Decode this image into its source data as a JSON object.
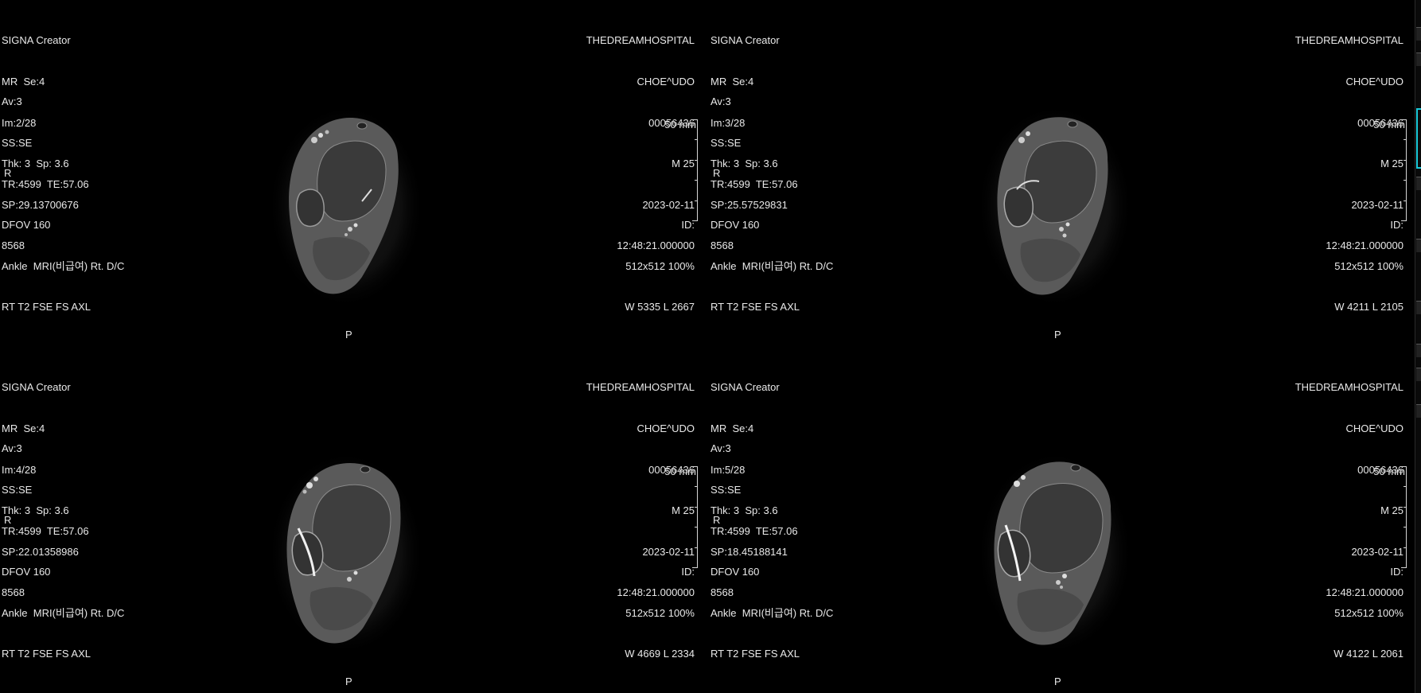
{
  "viewports": [
    {
      "top_left": [
        "SIGNA Creator",
        "MR  Se:4",
        "Im:2/28",
        "Thk: 3  Sp: 3.6",
        "SP:29.13700676",
        "8568"
      ],
      "top_right": [
        "THEDREAMHOSPITAL",
        "CHOE^UDO",
        "00056436",
        "M 25",
        "2023-02-11",
        "12:48:21.000000"
      ],
      "bottom_left": [
        "Av:3",
        "SS:SE",
        "TR:4599  TE:57.06",
        "DFOV 160",
        "Ankle  MRI(비급여) Rt. D/C",
        "RT T2 FSE FS AXL"
      ],
      "bottom_right": [
        "ID:",
        "512x512 100%",
        "W 5335 L 2667"
      ],
      "orientation_left": "R",
      "orientation_bottom": "P",
      "scale_label": "50 mm"
    },
    {
      "top_left": [
        "SIGNA Creator",
        "MR  Se:4",
        "Im:3/28",
        "Thk: 3  Sp: 3.6",
        "SP:25.57529831",
        "8568"
      ],
      "top_right": [
        "THEDREAMHOSPITAL",
        "CHOE^UDO",
        "00056436",
        "M 25",
        "2023-02-11",
        "12:48:21.000000"
      ],
      "bottom_left": [
        "Av:3",
        "SS:SE",
        "TR:4599  TE:57.06",
        "DFOV 160",
        "Ankle  MRI(비급여) Rt. D/C",
        "RT T2 FSE FS AXL"
      ],
      "bottom_right": [
        "ID:",
        "512x512 100%",
        "W 4211 L 2105"
      ],
      "orientation_left": "R",
      "orientation_bottom": "P",
      "scale_label": "50 mm"
    },
    {
      "top_left": [
        "SIGNA Creator",
        "MR  Se:4",
        "Im:4/28",
        "Thk: 3  Sp: 3.6",
        "SP:22.01358986",
        "8568"
      ],
      "top_right": [
        "THEDREAMHOSPITAL",
        "CHOE^UDO",
        "00056436",
        "M 25",
        "2023-02-11",
        "12:48:21.000000"
      ],
      "bottom_left": [
        "Av:3",
        "SS:SE",
        "TR:4599  TE:57.06",
        "DFOV 160",
        "Ankle  MRI(비급여) Rt. D/C",
        "RT T2 FSE FS AXL"
      ],
      "bottom_right": [
        "ID:",
        "512x512 100%",
        "W 4669 L 2334"
      ],
      "orientation_left": "R",
      "orientation_bottom": "P",
      "scale_label": "50 mm"
    },
    {
      "top_left": [
        "SIGNA Creator",
        "MR  Se:4",
        "Im:5/28",
        "Thk: 3  Sp: 3.6",
        "SP:18.45188141",
        "8568"
      ],
      "top_right": [
        "THEDREAMHOSPITAL",
        "CHOE^UDO",
        "00056436",
        "M 25",
        "2023-02-11",
        "12:48:21.000000"
      ],
      "bottom_left": [
        "Av:3",
        "SS:SE",
        "TR:4599  TE:57.06",
        "DFOV 160",
        "Ankle  MRI(비급여) Rt. D/C",
        "RT T2 FSE FS AXL"
      ],
      "bottom_right": [
        "ID:",
        "512x512 100%",
        "W 4122 L 2061"
      ],
      "orientation_left": "R",
      "orientation_bottom": "P",
      "scale_label": "50 mm"
    }
  ],
  "colors": {
    "background": "#000000",
    "overlay_text": "#e9e9e9",
    "active_highlight": "#18c8d8"
  }
}
